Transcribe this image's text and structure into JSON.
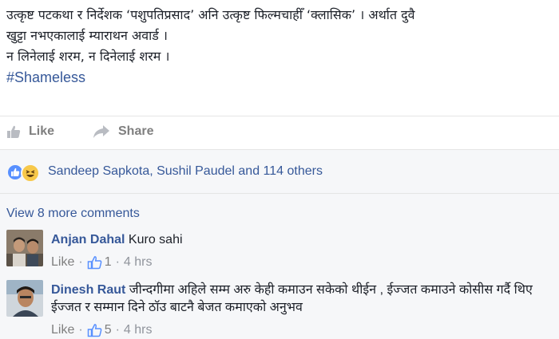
{
  "post": {
    "lines": [
      "उत्कृष्ट पटकथा र निर्देशक ‘पशुपतिप्रसाद’ अनि उत्कृष्ट फिल्मचाहीँ ‘क्लासिक’ । अर्थात दुवै",
      "खुट्टा नभएकालाई म्याराथन अवार्ड ।",
      "न लिनेलाई शरम, न दिनेलाई शरम ।"
    ],
    "hashtag": "#Shameless"
  },
  "actions": {
    "like_label": "Like",
    "share_label": "Share"
  },
  "reactions": {
    "summary": "Sandeep Sapkota, Sushil Paudel and 114 others",
    "icons": [
      "like-reaction-icon",
      "haha-reaction-icon"
    ]
  },
  "comments": {
    "view_more": "View 8 more comments",
    "items": [
      {
        "author": "Anjan Dahal",
        "text": "Kuro sahi",
        "like_label": "Like",
        "likes": "1",
        "dot": "·",
        "time": "4 hrs"
      },
      {
        "author": "Dinesh Raut",
        "text": "जीन्दगीमा अहिले सम्म अरु केही कमाउन सकेको थीईन , ईज्जत कमाउने कोसीस गर्दै थिए ईज्जत र सम्मान दिने ठॉउ बाटनै बेजत कमाएको अनुभव",
        "like_label": "Like",
        "likes": "5",
        "dot": "·",
        "time": "4 hrs"
      }
    ]
  },
  "colors": {
    "link": "#365899",
    "muted": "#7f7f7f",
    "panel_bg": "#f6f7f9",
    "like_reaction": "#5890ff",
    "haha_reaction": "#f7c84a"
  }
}
